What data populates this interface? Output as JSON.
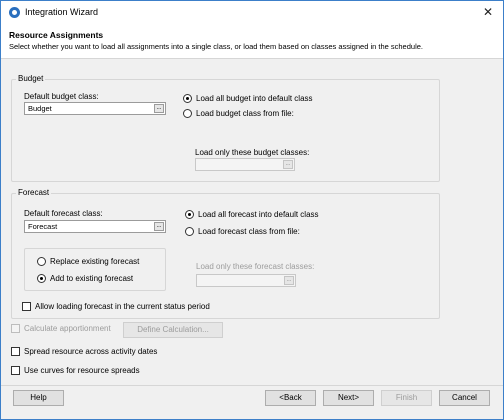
{
  "window": {
    "title": "Integration Wizard",
    "close_glyph": "✕"
  },
  "header": {
    "title": "Resource Assignments",
    "description": "Select whether you want to load all assignments into a single class, or load them based on classes assigned in the schedule."
  },
  "budget": {
    "group_label": "Budget",
    "default_class_label": "Default budget class:",
    "default_class_value": "Budget",
    "radio_default": "Load all budget into default class",
    "radio_file": "Load budget class from file:",
    "selected": "default",
    "only_classes_label": "Load only these budget classes:",
    "only_classes_value": ""
  },
  "forecast": {
    "group_label": "Forecast",
    "default_class_label": "Default forecast class:",
    "default_class_value": "Forecast",
    "radio_default": "Load all forecast into default class",
    "radio_file": "Load forecast class from file:",
    "selected": "default",
    "replace_label": "Replace existing forecast",
    "add_label": "Add to existing forecast",
    "mode_selected": "add",
    "only_classes_label": "Load only these forecast classes:",
    "only_classes_value": "",
    "current_period_label": "Allow loading forecast in the current status period"
  },
  "options": {
    "calc_apportionment_label": "Calculate apportionment",
    "define_calc_button": "Define Calculation...",
    "spread_label": "Spread resource across activity dates",
    "curves_label": "Use curves for resource spreads"
  },
  "footer": {
    "help": "Help",
    "back": "<Back",
    "next": "Next>",
    "finish": "Finish",
    "cancel": "Cancel"
  },
  "colors": {
    "accent": "#2a6fbe",
    "window_border": "#3c7fc9"
  },
  "icons": {
    "app": "integration-wizard-icon",
    "dropdown": "ellipsis-button-icon"
  }
}
